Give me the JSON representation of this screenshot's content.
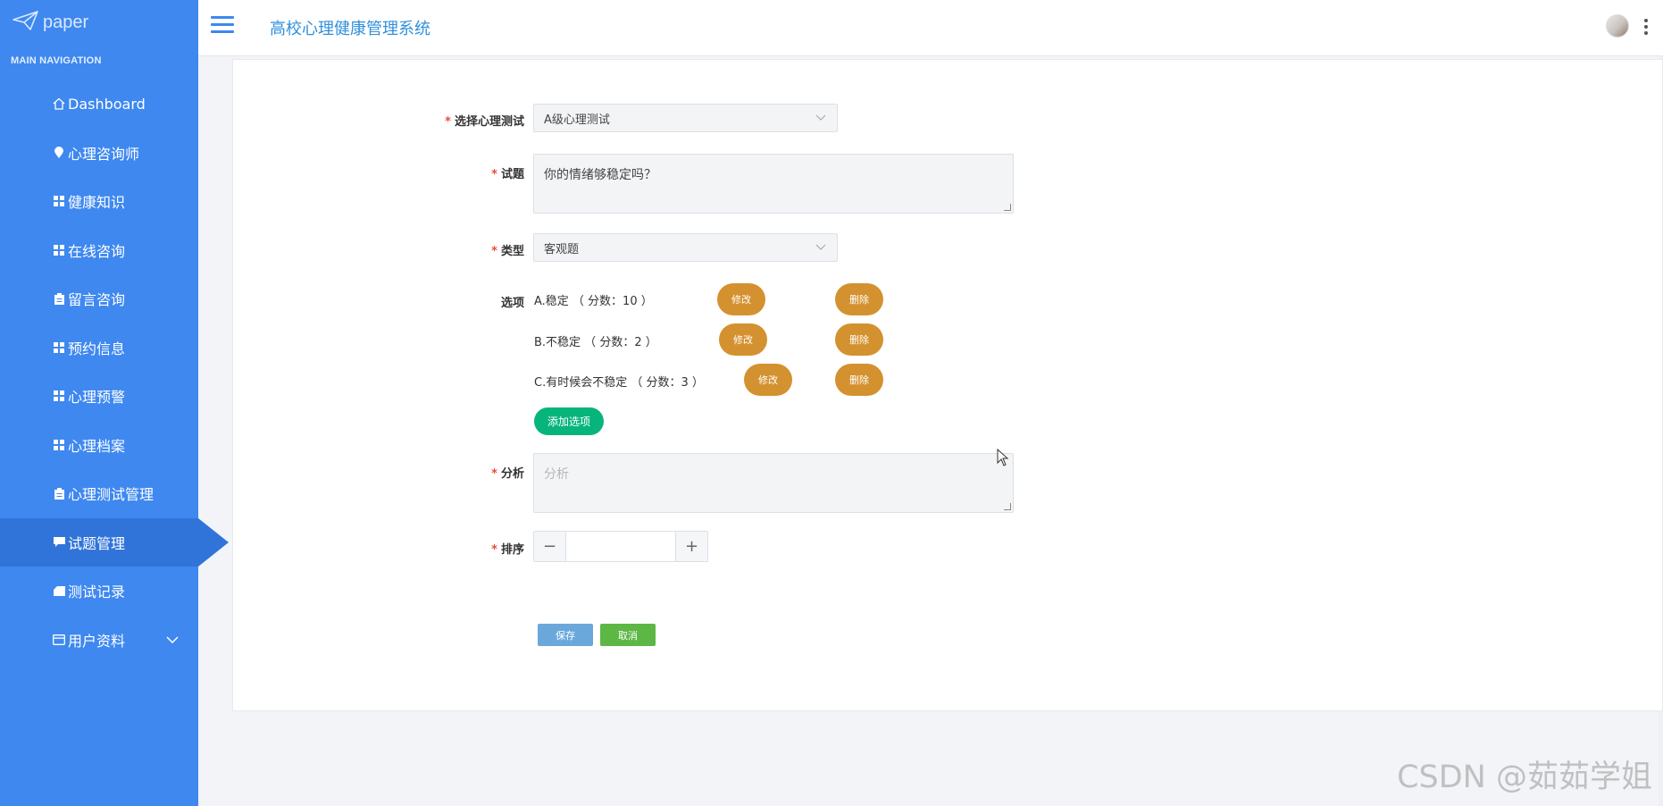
{
  "sidebar": {
    "logo_text": "paper",
    "nav_header": "MAIN NAVIGATION",
    "items": [
      {
        "label": "Dashboard",
        "icon": "home-icon"
      },
      {
        "label": "心理咨询师",
        "icon": "location-pin-icon"
      },
      {
        "label": "健康知识",
        "icon": "grid-icon"
      },
      {
        "label": "在线咨询",
        "icon": "grid-icon"
      },
      {
        "label": "留言咨询",
        "icon": "clipboard-icon"
      },
      {
        "label": "预约信息",
        "icon": "grid-icon"
      },
      {
        "label": "心理预警",
        "icon": "grid-icon"
      },
      {
        "label": "心理档案",
        "icon": "grid-icon"
      },
      {
        "label": "心理测试管理",
        "icon": "clipboard-icon"
      },
      {
        "label": "试题管理",
        "icon": "comment-icon",
        "active": true
      },
      {
        "label": "测试记录",
        "icon": "tag-icon"
      },
      {
        "label": "用户资料",
        "icon": "card-icon",
        "expandable": true
      }
    ]
  },
  "header": {
    "title": "高校心理健康管理系统"
  },
  "form": {
    "test_label": "选择心理测试",
    "test_value": "A级心理测试",
    "question_label": "试题",
    "question_value": "你的情绪够稳定吗？",
    "type_label": "类型",
    "type_value": "客观题",
    "options_label": "选项",
    "options": [
      {
        "text": "A.稳定 （ 分数：10 ）"
      },
      {
        "text": "B.不稳定 （ 分数：2 ）"
      },
      {
        "text": "C.有时候会不稳定 （ 分数：3 ）"
      }
    ],
    "edit_label": "修改",
    "delete_label": "删除",
    "add_option_label": "添加选项",
    "analysis_label": "分析",
    "analysis_placeholder": "分析",
    "sort_label": "排序",
    "sort_minus": "−",
    "sort_plus": "+",
    "save_label": "保存",
    "cancel_label": "取消"
  },
  "watermark": "CSDN @茹茹学姐",
  "colors": {
    "sidebar": "#3e88f0",
    "sidebar_active": "#3174d9",
    "pill": "#d4912f",
    "add": "#07b57c",
    "save": "#6aa8dc",
    "cancel": "#5cb744"
  }
}
